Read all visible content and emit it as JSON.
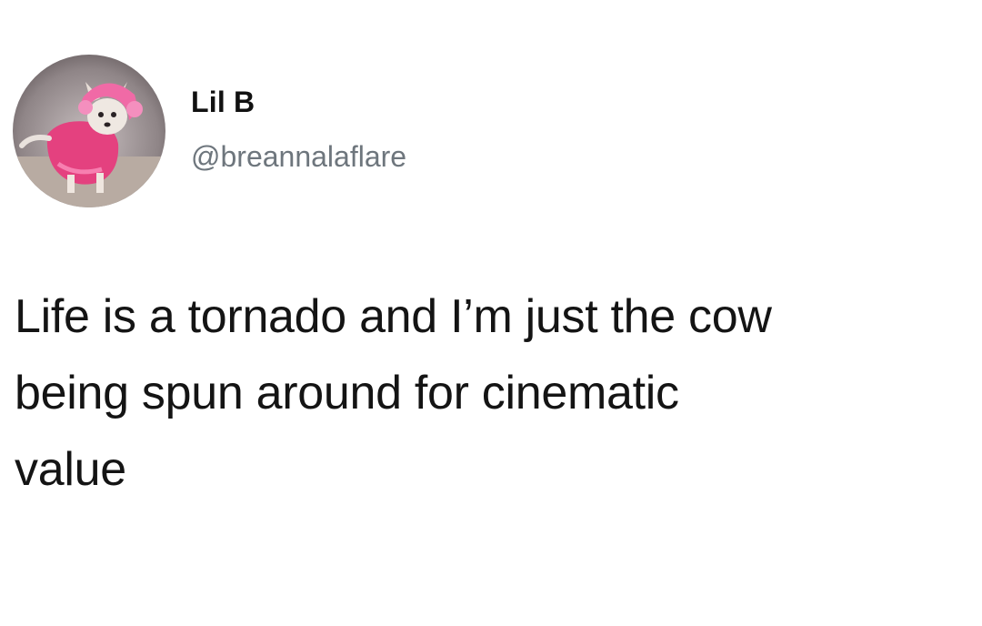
{
  "author": {
    "display_name": "Lil B",
    "handle": "@breannalaflare"
  },
  "tweet": {
    "lines": [
      "Life is a tornado and I’m just the cow",
      "being spun around for cinematic",
      "value"
    ]
  },
  "colors": {
    "background": "#ffffff",
    "text": "#141414",
    "handle": "#6e767d"
  }
}
